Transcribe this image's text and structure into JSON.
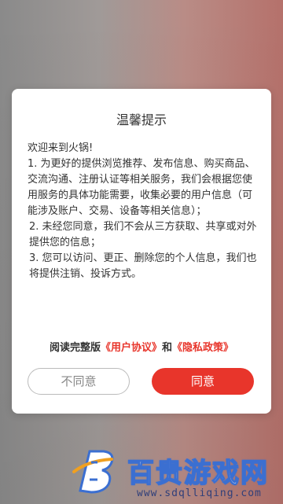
{
  "dialog": {
    "title": "温馨提示",
    "lines": [
      "欢迎来到火锅!",
      "1. 为更好的提供浏览推荐、发布信息、购买商品、交流沟通、注册认证等相关服务，我们会根据您使用服务的具体功能需要，收集必要的用户信息（可能涉及账户、交易、设备等相关信息）；",
      "2. 未经您同意，我们不会从三方获取、共享或对外提供您的信息；",
      "3. 您可以访问、更正、删除您的个人信息，我们也将提供注销、投诉方式。"
    ],
    "read_prefix": "阅读完整版",
    "user_agreement": "《用户协议》",
    "and": "和",
    "privacy_policy": "《隐私政策》",
    "disagree_label": "不同意",
    "agree_label": "同意",
    "accent_color": "#e8352b"
  },
  "watermark": {
    "title": "百贵游戏网",
    "url": "www.sdqlliqing.com",
    "logo_icon": "b-logo-icon"
  }
}
